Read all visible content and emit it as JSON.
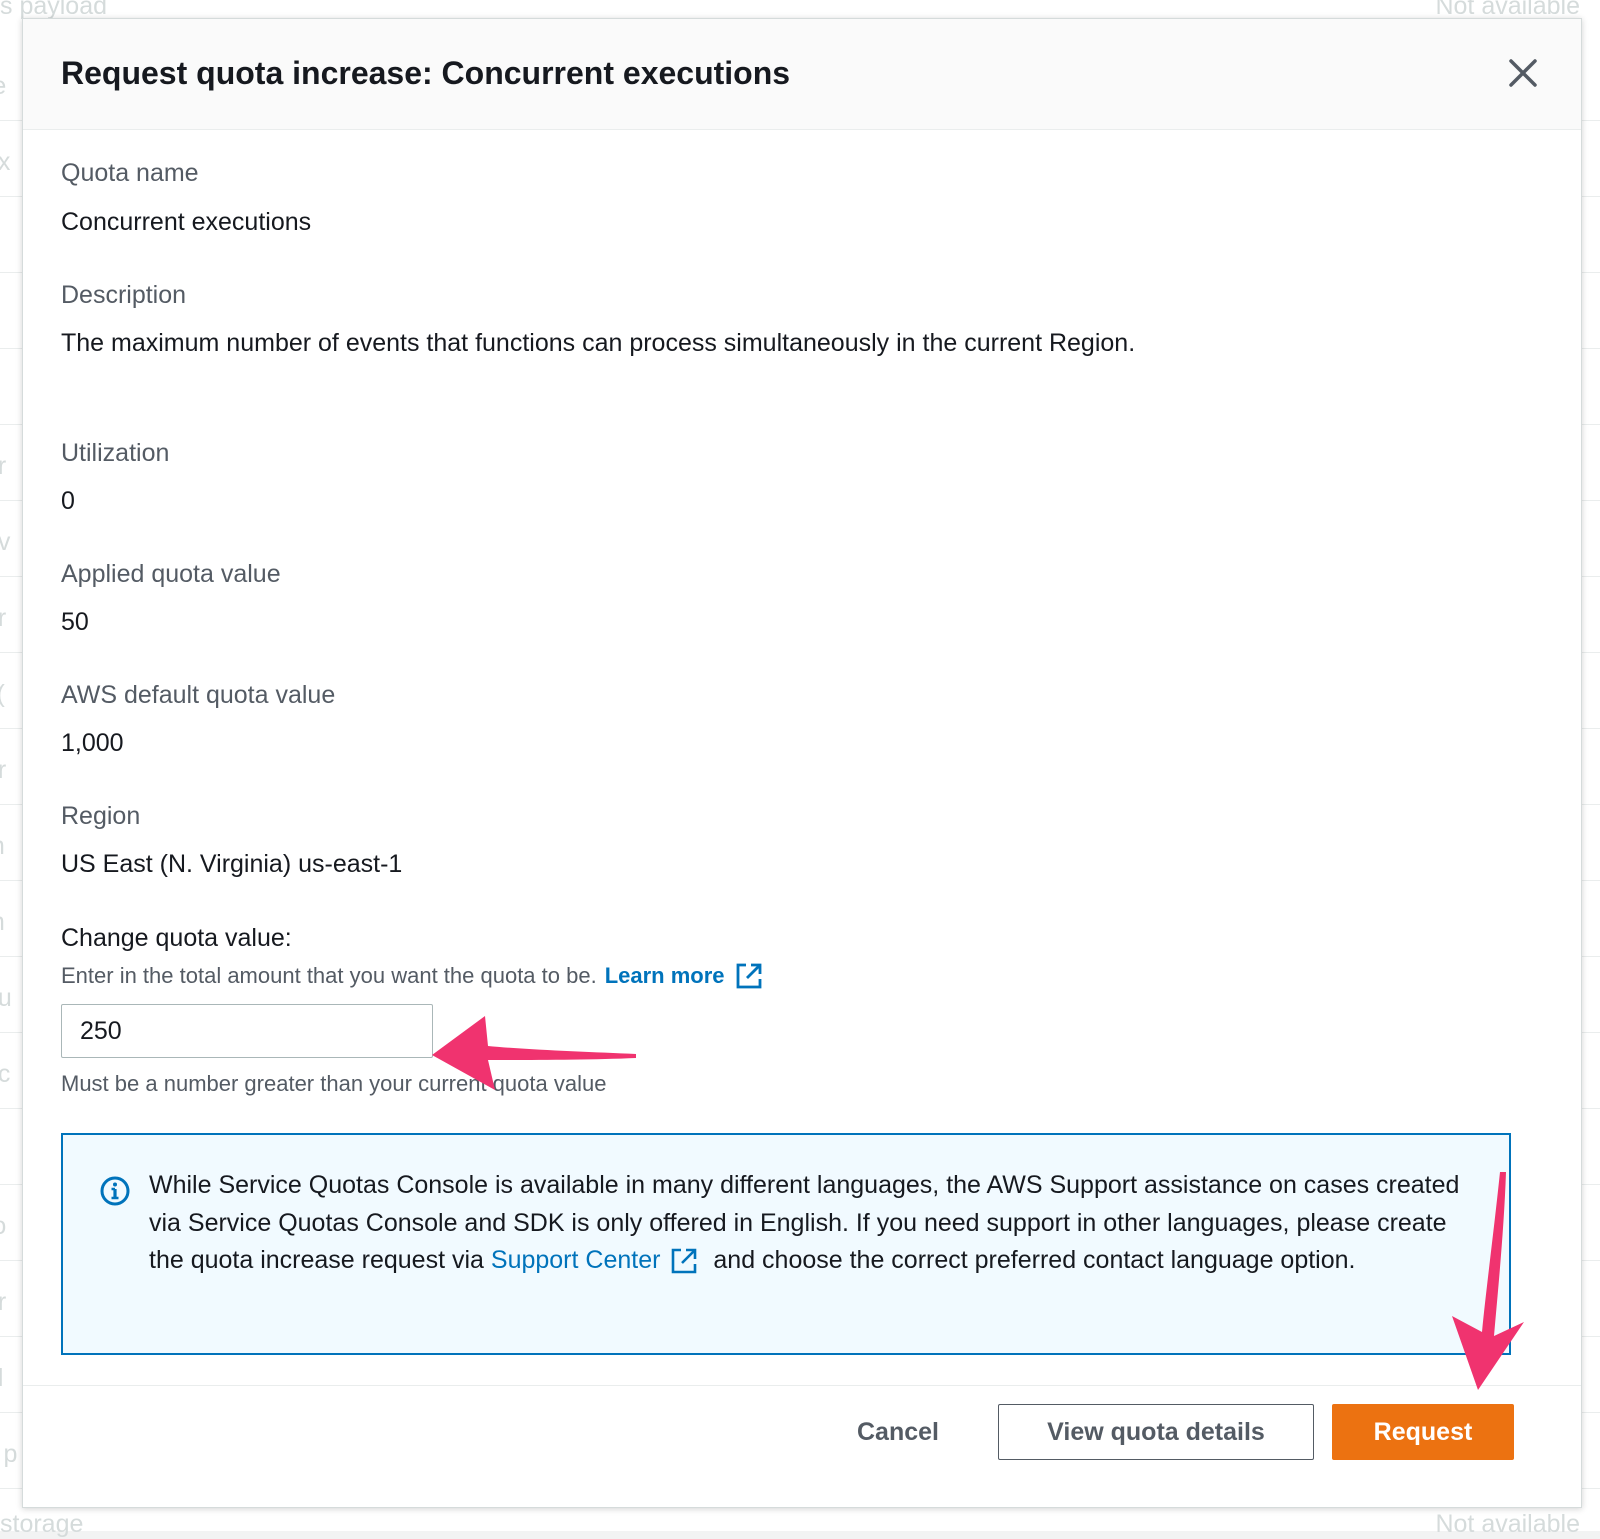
{
  "background": {
    "top_left_text": "s payload",
    "top_right_text": "Not available",
    "bottom_left_text": "storage",
    "bottom_right_text": "Not available",
    "row_fragments": [
      "re",
      "ex",
      "p",
      "p",
      "p",
      "or",
      "t v",
      "or",
      "l (",
      "er",
      "m",
      "m",
      "ou",
      "ec",
      "d",
      "ro",
      "ur",
      "ol",
      "s p"
    ]
  },
  "modal": {
    "title": "Request quota increase: Concurrent executions",
    "fields": [
      {
        "label": "Quota name",
        "value": "Concurrent executions"
      },
      {
        "label": "Description",
        "value": "The maximum number of events that functions can process simultaneously in the current Region."
      },
      {
        "label": "Utilization",
        "value": "0"
      },
      {
        "label": "Applied quota value",
        "value": "50"
      },
      {
        "label": "AWS default quota value",
        "value": "1,000"
      },
      {
        "label": "Region",
        "value": "US East (N. Virginia) us-east-1"
      }
    ],
    "change": {
      "label": "Change quota value:",
      "description": "Enter in the total amount that you want the quota to be.",
      "learn_more": "Learn more",
      "input_value": "250",
      "constraint": "Must be a number greater than your current quota value"
    },
    "info": {
      "text_before": "While Service Quotas Console is available in many different languages, the AWS Support assistance on cases created via Service Quotas Console and SDK is only offered in English. If you need support in other languages, please create the quota increase request via",
      "link": "Support Center",
      "text_after": "and choose the correct preferred contact language option."
    },
    "footer": {
      "cancel": "Cancel",
      "view_details": "View quota details",
      "request": "Request"
    }
  },
  "colors": {
    "link": "#0073bb",
    "primary_button": "#ec7211",
    "info_border": "#0073bb",
    "info_background": "#f1faff",
    "annotation_arrow": "#f0336f"
  },
  "icons": {
    "close": "close-icon",
    "external_link": "external-link-icon",
    "info": "info-icon"
  }
}
